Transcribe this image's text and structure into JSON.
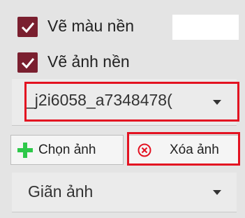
{
  "options": {
    "draw_background_color": {
      "label": "Vẽ màu nền",
      "checked": true
    },
    "draw_background_image": {
      "label": "Vẽ ảnh nền",
      "checked": true
    }
  },
  "image_select": {
    "value": "_j2i6058_a7348478("
  },
  "buttons": {
    "choose_image": "Chọn ảnh",
    "delete_image": "Xóa ảnh"
  },
  "stretch_select": {
    "value": "Giãn ảnh"
  },
  "colors": {
    "checkbox": "#7a1f2f",
    "highlight": "#e31221",
    "add_icon": "#2ec84a",
    "delete_icon": "#e31221"
  }
}
